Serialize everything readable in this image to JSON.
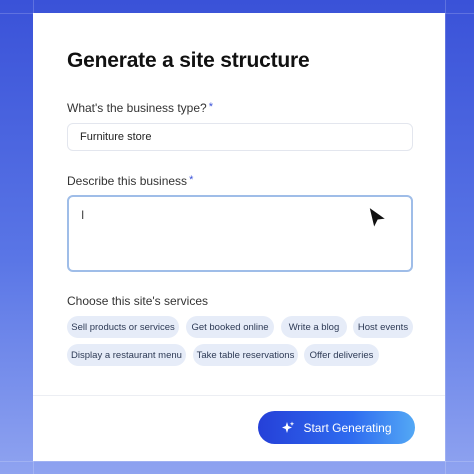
{
  "form": {
    "title": "Generate a site structure",
    "business_type_label": "What's the business type?",
    "business_type_value": "Furniture store",
    "required_mark": "*",
    "describe_label": "Describe this business",
    "describe_value": "I",
    "services_label": "Choose this site's services",
    "services": [
      "Sell products or services",
      "Get booked online",
      "Write a blog",
      "Host events",
      "Display a restaurant menu",
      "Take table reservations",
      "Offer deliveries"
    ],
    "submit_label": "Start Generating"
  },
  "icons": {
    "sparkle": "sparkle-icon",
    "cursor": "mouse-pointer-icon"
  },
  "colors": {
    "background_top": "#3a52d8",
    "background_bottom": "#8fa3f0",
    "chip_bg": "#e6ecf8",
    "button_gradient_start": "#2540d8",
    "button_gradient_end": "#53a8f5",
    "focus_border": "#9fbde8"
  }
}
